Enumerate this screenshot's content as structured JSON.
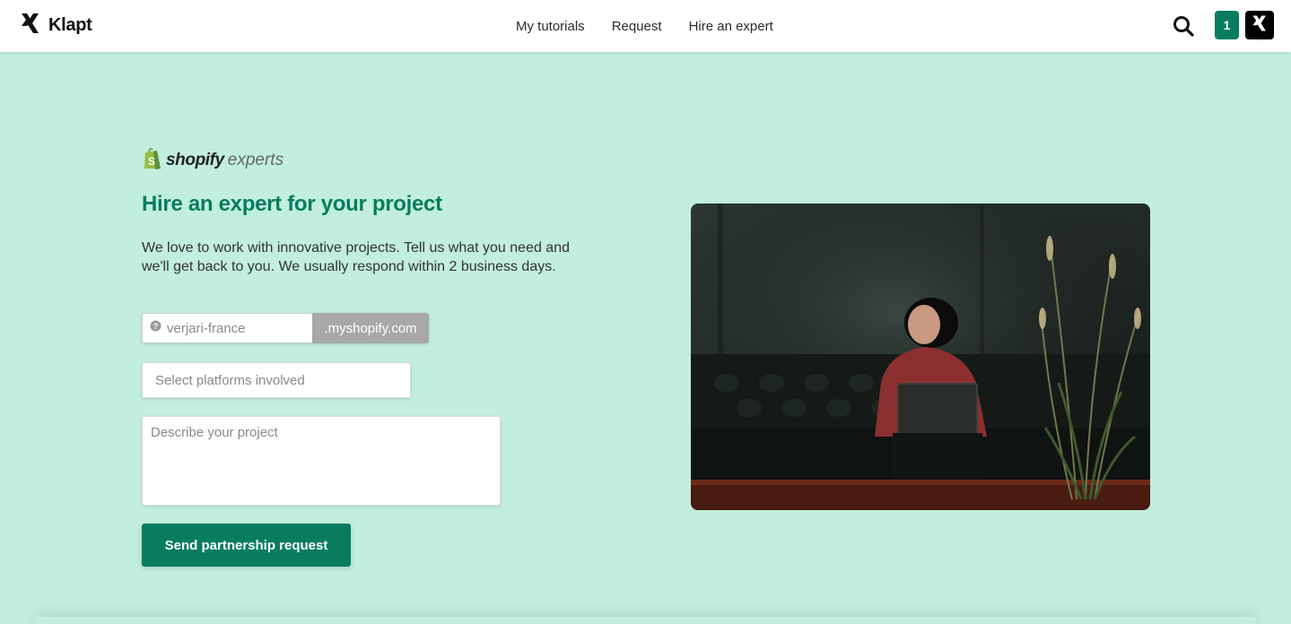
{
  "header": {
    "brand_name": "Klapt",
    "nav": [
      {
        "label": "My tutorials"
      },
      {
        "label": "Request"
      },
      {
        "label": "Hire an expert"
      }
    ],
    "notification_count": "1"
  },
  "main": {
    "shopify_logo": {
      "word": "shopify",
      "suffix": "experts"
    },
    "headline": "Hire an expert for your project",
    "intro": "We love to work with innovative projects. Tell us what you need and we'll get back to you. We usually respond within 2 business days.",
    "store_field": {
      "placeholder": "verjari-france",
      "suffix": ".myshopify.com"
    },
    "platforms_placeholder": "Select platforms involved",
    "description_placeholder": "Describe your project",
    "submit_label": "Send partnership request"
  },
  "colors": {
    "background": "#c1eedd",
    "accent": "#077d5d",
    "suffix_bg": "#a8a8a8"
  },
  "icons": {
    "brand": "klapt-logo-icon",
    "search": "search-icon",
    "help": "question-circle-icon",
    "shopify_bag": "shopify-bag-icon"
  }
}
